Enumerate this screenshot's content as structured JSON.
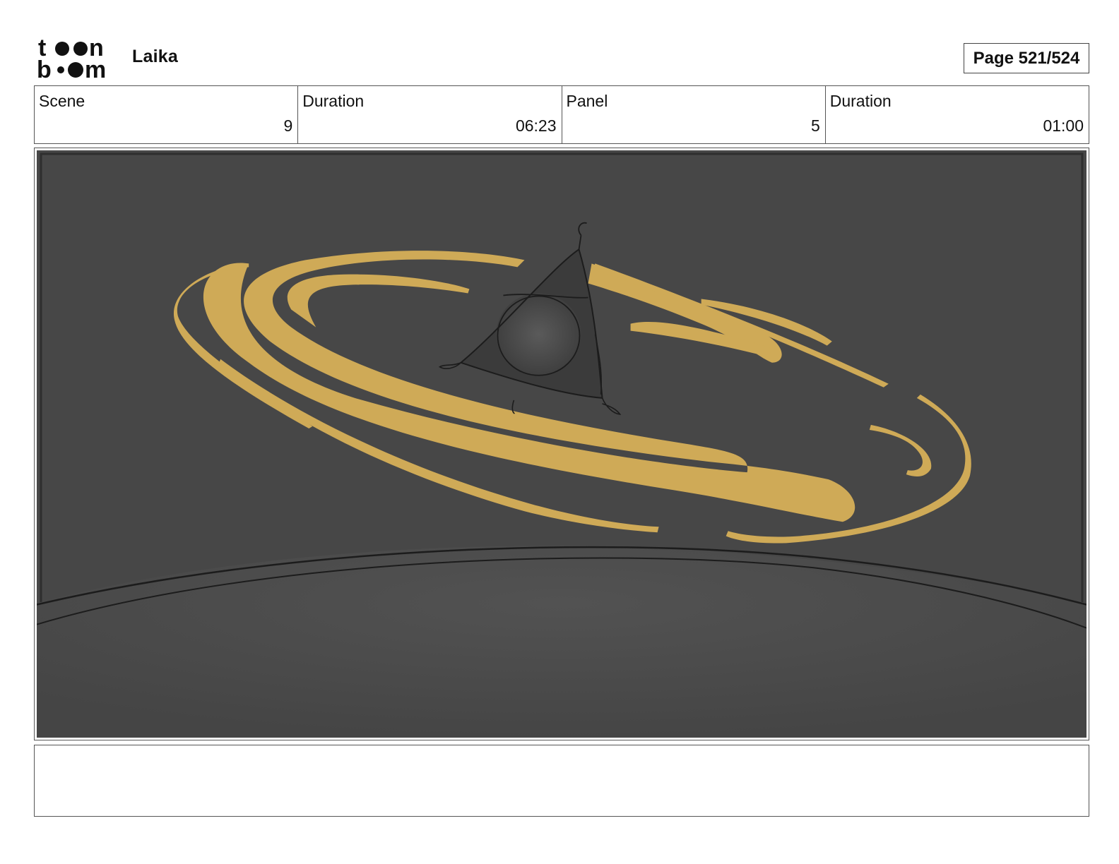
{
  "header": {
    "logo_text": "toon boom",
    "project_title": "Laika",
    "page_label": "Page 521/524"
  },
  "info": [
    {
      "label": "Scene",
      "value": "9"
    },
    {
      "label": "Duration",
      "value": "06:23"
    },
    {
      "label": "Panel",
      "value": "5"
    },
    {
      "label": "Duration",
      "value": "01:00"
    }
  ],
  "panel": {
    "background_color": "#474747",
    "ring_color": "#cfaa57",
    "line_color": "#1c1c1c"
  },
  "notes": {
    "text": ""
  }
}
